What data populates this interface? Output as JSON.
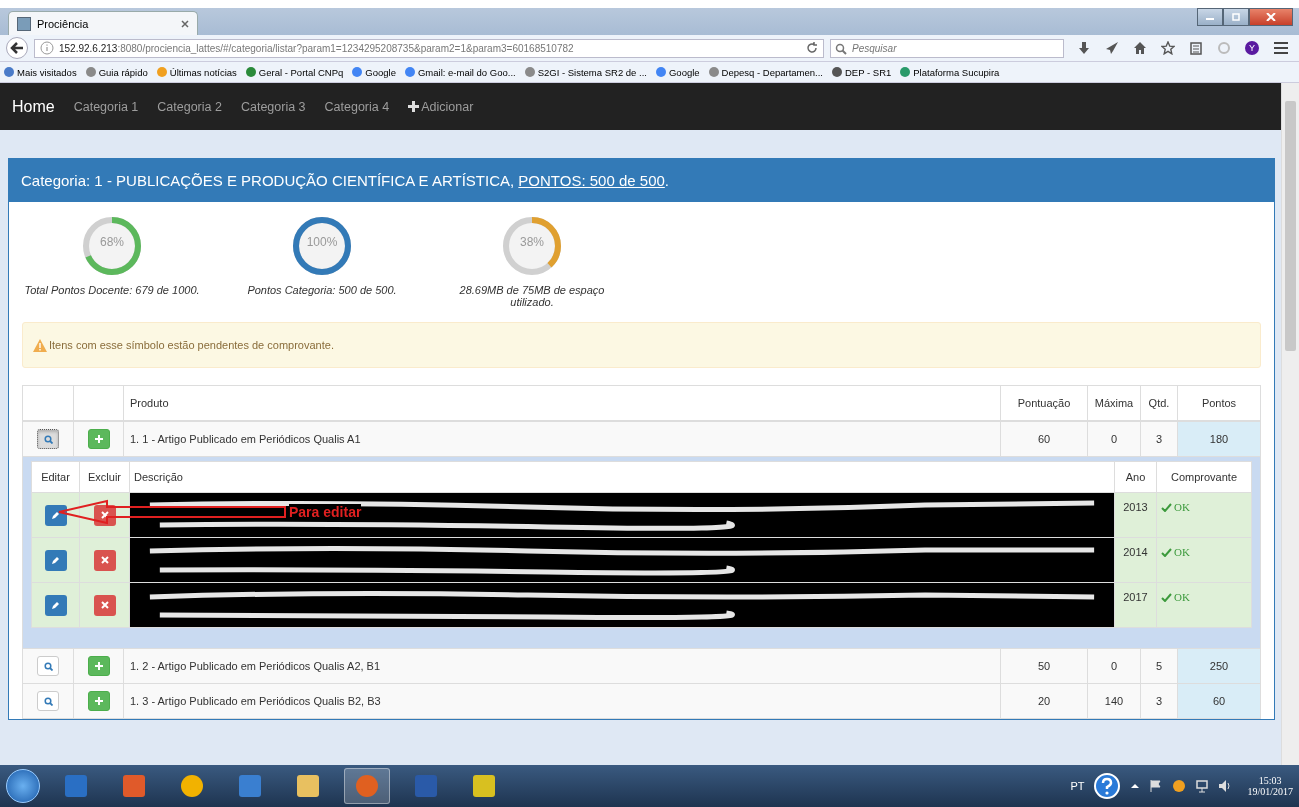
{
  "browser": {
    "tab_title": "Prociência",
    "url_host": "152.92.6.213",
    "url_path": ":8080/prociencia_lattes/#/categoria/listar?param1=1234295208735&param2=1&param3=60168510782",
    "search_placeholder": "Pesquisar",
    "profile_initial": "Y",
    "bookmarks": [
      {
        "label": "Mais visitados",
        "color": "#4a7bc8"
      },
      {
        "label": "Guia rápido",
        "color": "#8a8a8a"
      },
      {
        "label": "Últimas notícias",
        "color": "#f0a020"
      },
      {
        "label": "Geral - Portal CNPq",
        "color": "#2a8a3a"
      },
      {
        "label": "Google",
        "color": "#4285f4"
      },
      {
        "label": "Gmail: e-mail do Goo...",
        "color": "#4285f4"
      },
      {
        "label": "S2GI - Sistema SR2 de ...",
        "color": "#8a8a8a"
      },
      {
        "label": "Google",
        "color": "#4285f4"
      },
      {
        "label": "Depesq - Departamen...",
        "color": "#8a8a8a"
      },
      {
        "label": "DEP - SR1",
        "color": "#555555"
      },
      {
        "label": "Plataforma Sucupira",
        "color": "#2a9a6a"
      }
    ]
  },
  "navbar": {
    "items": [
      {
        "label": "Home",
        "kind": "brand"
      },
      {
        "label": "Categoria 1",
        "kind": "link"
      },
      {
        "label": "Categoria 2",
        "kind": "link"
      },
      {
        "label": "Categoria 3",
        "kind": "link"
      },
      {
        "label": "Categoria 4",
        "kind": "link"
      },
      {
        "label": "Adicionar",
        "kind": "add"
      }
    ]
  },
  "panel": {
    "heading": "Categoria: 1 - PUBLICAÇÕES E PRODUÇÃO CIENTÍFICA E ARTÍSTICA, ",
    "heading_link": "PONTOS: 500 de 500",
    "heading_end": "."
  },
  "gauges": [
    {
      "percent": "68%",
      "level": 0.68,
      "color": "#5cb85c",
      "caption": "Total Pontos Docente: 679 de 1000."
    },
    {
      "percent": "100%",
      "level": 1,
      "color": "#337ab7",
      "caption": "Pontos Categoria: 500 de 500."
    },
    {
      "percent": "38%",
      "level": 0.38,
      "color": "#e0a030",
      "caption": "28.69MB de 75MB de espaço utilizado."
    }
  ],
  "alert": "Itens com esse símbolo estão pendentes de comprovante.",
  "table": {
    "columns": [
      "Produto",
      "Pontuação",
      "Máxima",
      "Qtd.",
      "Pontos"
    ],
    "rows": [
      {
        "product": "1. 1 - Artigo Publicado em Periódicos Qualis A1",
        "pontuacao": "60",
        "maxima": "0",
        "qtd": "3",
        "pontos": "180",
        "expanded": true
      },
      {
        "product": "1. 2 - Artigo Publicado em Periódicos Qualis A2, B1",
        "pontuacao": "50",
        "maxima": "0",
        "qtd": "5",
        "pontos": "250",
        "expanded": false
      },
      {
        "product": "1. 3 - Artigo Publicado em Periódicos Qualis B2, B3",
        "pontuacao": "20",
        "maxima": "140",
        "qtd": "3",
        "pontos": "60",
        "expanded": false
      }
    ],
    "detail": {
      "columns": [
        "Editar",
        "Excluir",
        "Descrição",
        "Ano",
        "Comprovante"
      ],
      "entries": [
        {
          "ano": "2013",
          "status": "OK"
        },
        {
          "ano": "2014",
          "status": "OK"
        },
        {
          "ano": "2017",
          "status": "OK"
        }
      ]
    }
  },
  "annotation": {
    "label": "Para editar"
  },
  "taskbar": {
    "language": "PT",
    "time": "15:03",
    "date": "19/01/2017"
  }
}
